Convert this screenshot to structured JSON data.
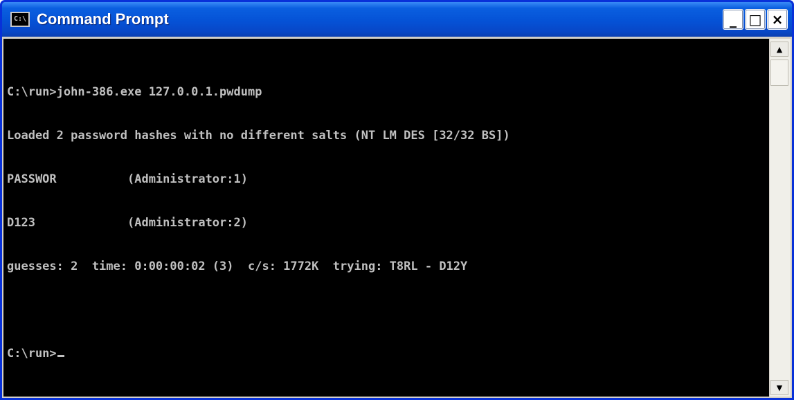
{
  "window": {
    "title": "Command Prompt",
    "icon": "console-icon",
    "icon_text": "C:\\",
    "buttons": {
      "minimize": "_",
      "maximize": "□",
      "close": "×"
    }
  },
  "console": {
    "lines": [
      "C:\\run>john-386.exe 127.0.0.1.pwdump",
      "Loaded 2 password hashes with no different salts (NT LM DES [32/32 BS])",
      "PASSWOR          (Administrator:1)",
      "D123             (Administrator:2)",
      "guesses: 2  time: 0:00:00:02 (3)  c/s: 1772K  trying: T8RL - D12Y",
      "",
      "C:\\run>"
    ]
  },
  "scrollbar": {
    "up": "▲",
    "down": "▼"
  }
}
